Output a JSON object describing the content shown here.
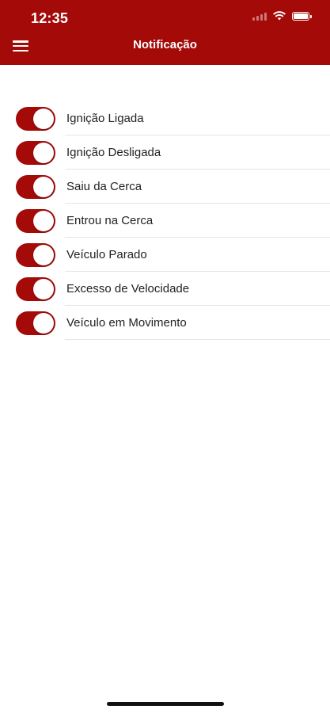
{
  "status_bar": {
    "time": "12:35",
    "icons": [
      "cellular-signal-icon",
      "wifi-icon",
      "battery-icon"
    ]
  },
  "header": {
    "title": "Notificação",
    "menu_icon": "hamburger-menu-icon"
  },
  "colors": {
    "brand": "#a30a08",
    "background": "#ffffff",
    "text": "#222222",
    "divider": "#e6e6e6"
  },
  "notifications": [
    {
      "label": "Ignição Ligada",
      "enabled": true
    },
    {
      "label": "Ignição Desligada",
      "enabled": true
    },
    {
      "label": "Saiu da Cerca",
      "enabled": true
    },
    {
      "label": "Entrou na Cerca",
      "enabled": true
    },
    {
      "label": "Veículo Parado",
      "enabled": true
    },
    {
      "label": "Excesso de Velocidade",
      "enabled": true
    },
    {
      "label": "Veículo em Movimento",
      "enabled": true
    }
  ]
}
